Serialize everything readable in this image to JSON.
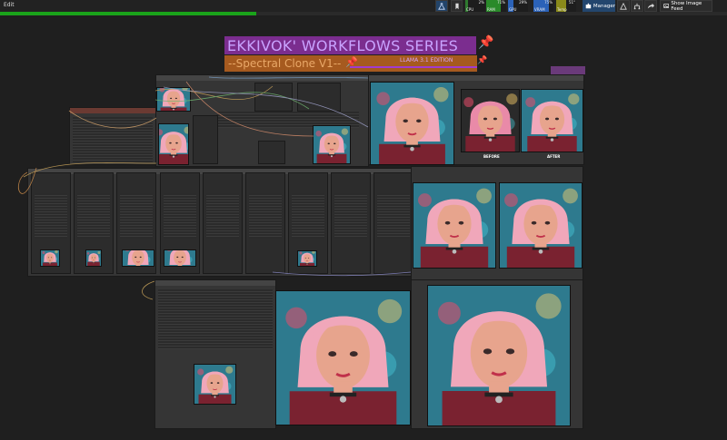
{
  "menu": {
    "edit": "Edit"
  },
  "queue": {
    "progress": 0.353
  },
  "monitors": [
    {
      "label": "CPU",
      "pct": "2%",
      "color": "#2f7a2f",
      "fill": 0.02
    },
    {
      "label": "RAM",
      "pct": "71%",
      "color": "#2a8a2a",
      "fill": 0.71
    },
    {
      "label": "GPU",
      "pct": "29%",
      "color": "#2b62b8",
      "fill": 0.29
    },
    {
      "label": "VRAM",
      "pct": "75%",
      "color": "#2b62b8",
      "fill": 0.75
    },
    {
      "label": "Temp",
      "pct": "51°",
      "color": "#8a8a1a",
      "fill": 0.51
    }
  ],
  "toolbar": {
    "manager_label": "Manager",
    "show_image_feed_label": "Show Image Feed"
  },
  "canvas": {
    "title": "EKKIVOK' WORKFLOWS SERIES",
    "subtitle": "--Spectral Clone V1--",
    "edition": "LLAMA 3.1 EDITION",
    "comparison": {
      "before_label": "BEFORE",
      "after_label": "AFTER"
    }
  },
  "colors": {
    "title_bg": "#7b2d8f",
    "subtitle_bg": "#a65a1f",
    "hair": "#f0a7ba",
    "skin": "#e7a48d",
    "neon_bg": "#2e7a8e",
    "outfit": "#7a2230"
  }
}
